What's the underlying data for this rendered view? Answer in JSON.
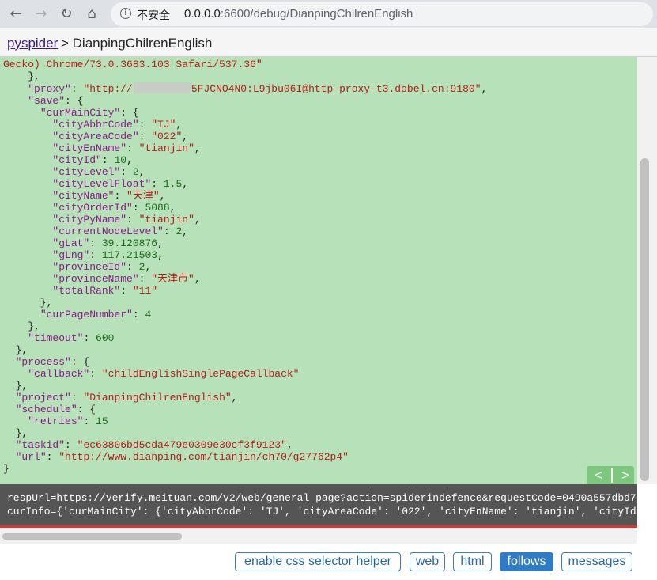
{
  "browser": {
    "back_icon": "←",
    "forward_icon": "→",
    "reload_icon": "↻",
    "home_icon": "⌂",
    "security_label": "不安全",
    "url_host": "0.0.0.0",
    "url_rest": ":6600/debug/DianpingChilrenEnglish"
  },
  "header": {
    "app_link": "pyspider",
    "crumb_rest": " > DianpingChilrenEnglish"
  },
  "json": {
    "line1": "Gecko) Chrome/73.0.3683.103 Safari/537.36\"",
    "proxy_key": "\"proxy\"",
    "proxy_prefix": "\"http://",
    "proxy_suffix": "5FJCNO4N0:L9jbu06I@http-proxy-t3.dobel.cn:9180\"",
    "save_key": "\"save\"",
    "cur_main_city_key": "\"curMainCity\"",
    "city": [
      {
        "k": "\"cityAbbrCode\"",
        "v": "\"TJ\"",
        "t": "s"
      },
      {
        "k": "\"cityAreaCode\"",
        "v": "\"022\"",
        "t": "s"
      },
      {
        "k": "\"cityEnName\"",
        "v": "\"tianjin\"",
        "t": "s"
      },
      {
        "k": "\"cityId\"",
        "v": "10",
        "t": "n"
      },
      {
        "k": "\"cityLevel\"",
        "v": "2",
        "t": "n"
      },
      {
        "k": "\"cityLevelFloat\"",
        "v": "1.5",
        "t": "n"
      },
      {
        "k": "\"cityName\"",
        "v": "\"天津\"",
        "t": "s"
      },
      {
        "k": "\"cityOrderId\"",
        "v": "5088",
        "t": "n"
      },
      {
        "k": "\"cityPyName\"",
        "v": "\"tianjin\"",
        "t": "s"
      },
      {
        "k": "\"currentNodeLevel\"",
        "v": "2",
        "t": "n"
      },
      {
        "k": "\"gLat\"",
        "v": "39.120876",
        "t": "n"
      },
      {
        "k": "\"gLng\"",
        "v": "117.21503",
        "t": "n"
      },
      {
        "k": "\"provinceId\"",
        "v": "2",
        "t": "n"
      },
      {
        "k": "\"provinceName\"",
        "v": "\"天津市\"",
        "t": "s"
      },
      {
        "k": "\"totalRank\"",
        "v": "\"11\"",
        "t": "s"
      }
    ],
    "cur_page_number_key": "\"curPageNumber\"",
    "cur_page_number": "4",
    "timeout_key": "\"timeout\"",
    "timeout": "600",
    "process_key": "\"process\"",
    "callback_key": "\"callback\"",
    "callback": "\"childEnglishSinglePageCallback\"",
    "project_key": "\"project\"",
    "project": "\"DianpingChilrenEnglish\"",
    "schedule_key": "\"schedule\"",
    "retries_key": "\"retries\"",
    "retries": "15",
    "taskid_key": "\"taskid\"",
    "taskid": "\"ec63806bd5cda479e0309e30cf3f9123\"",
    "url_key": "\"url\"",
    "url": "\"http://www.dianping.com/tianjin/ch70/g27762p4\""
  },
  "pager": {
    "prev": "<",
    "next": ">"
  },
  "console": {
    "line1": "respUrl=https://verify.meituan.com/v2/web/general_page?action=spiderindefence&requestCode=0490a557dbd7",
    "line2": "curInfo={'curMainCity': {'cityAbbrCode': 'TJ', 'cityAreaCode': '022', 'cityEnName': 'tianjin', 'cityId"
  },
  "toolbar": {
    "css_helper": "enable css selector helper",
    "web": "web",
    "html": "html",
    "follows": "follows",
    "messages": "messages"
  }
}
